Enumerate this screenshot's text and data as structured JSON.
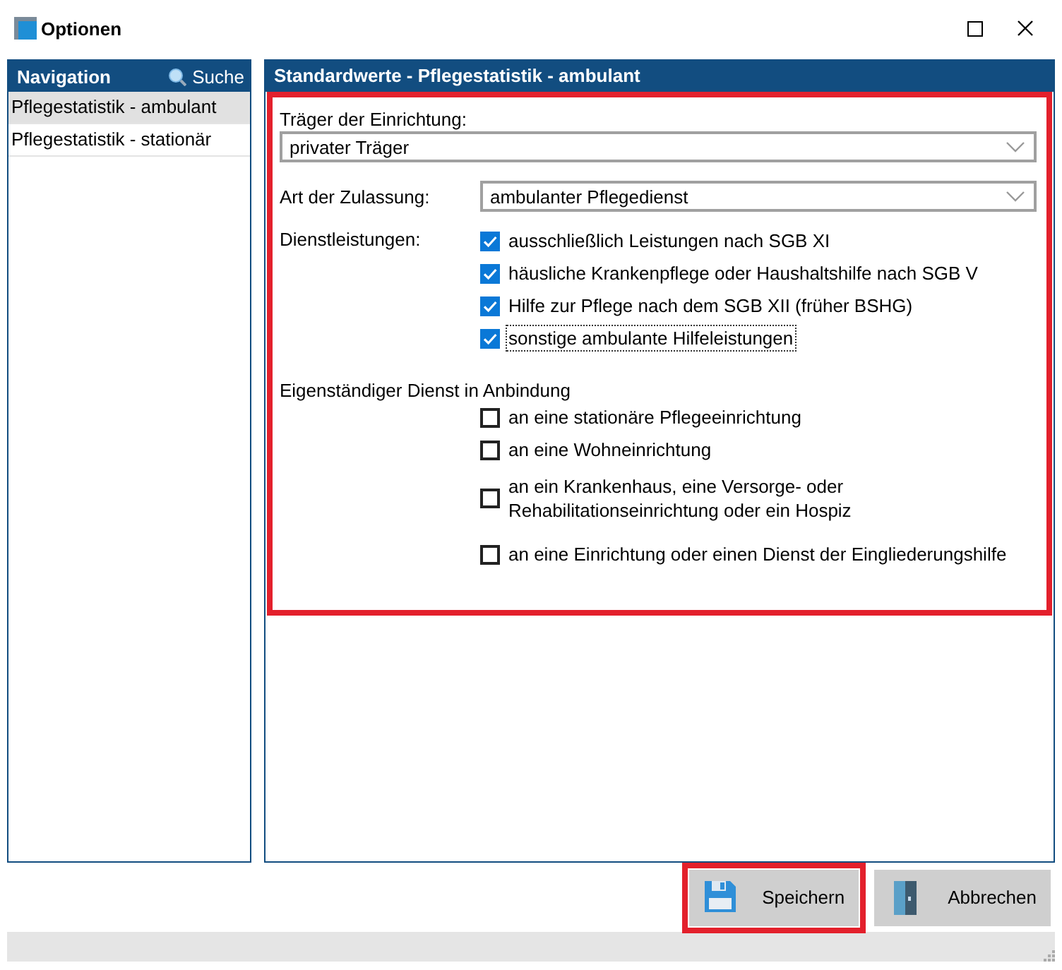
{
  "window": {
    "title": "Optionen"
  },
  "navigation": {
    "title": "Navigation",
    "search_label": "Suche",
    "items": [
      {
        "label": "Pflegestatistik - ambulant",
        "selected": true
      },
      {
        "label": "Pflegestatistik - stationär",
        "selected": false
      }
    ]
  },
  "panel": {
    "title": "Standardwerte - Pflegestatistik - ambulant",
    "traeger": {
      "label": "Träger der Einrichtung:",
      "value": "privater Träger"
    },
    "zulassung": {
      "label": "Art der Zulassung:",
      "value": "ambulanter Pflegedienst"
    },
    "dienstleistungen": {
      "label": "Dienstleistungen:",
      "options": [
        {
          "label": "ausschließlich Leistungen nach SGB XI",
          "checked": true,
          "focused": false
        },
        {
          "label": "häusliche Krankenpflege oder Haushaltshilfe nach SGB V",
          "checked": true,
          "focused": false
        },
        {
          "label": "Hilfe zur Pflege nach dem SGB XII (früher BSHG)",
          "checked": true,
          "focused": false
        },
        {
          "label": "sonstige ambulante Hilfeleistungen",
          "checked": true,
          "focused": true
        }
      ]
    },
    "anbindung": {
      "label": "Eigenständiger Dienst in Anbindung",
      "options": [
        {
          "label": "an eine stationäre Pflegeeinrichtung",
          "checked": false
        },
        {
          "label": "an eine Wohneinrichtung",
          "checked": false
        },
        {
          "label": "an ein Krankenhaus, eine Versorge- oder\nRehabilitationseinrichtung oder ein Hospiz",
          "checked": false
        },
        {
          "label": "an eine Einrichtung oder einen Dienst der Eingliederungshilfe",
          "checked": false
        }
      ]
    }
  },
  "buttons": [
    {
      "label": "Speichern",
      "kind": "save"
    },
    {
      "label": "Abbrechen",
      "kind": "cancel"
    }
  ]
}
